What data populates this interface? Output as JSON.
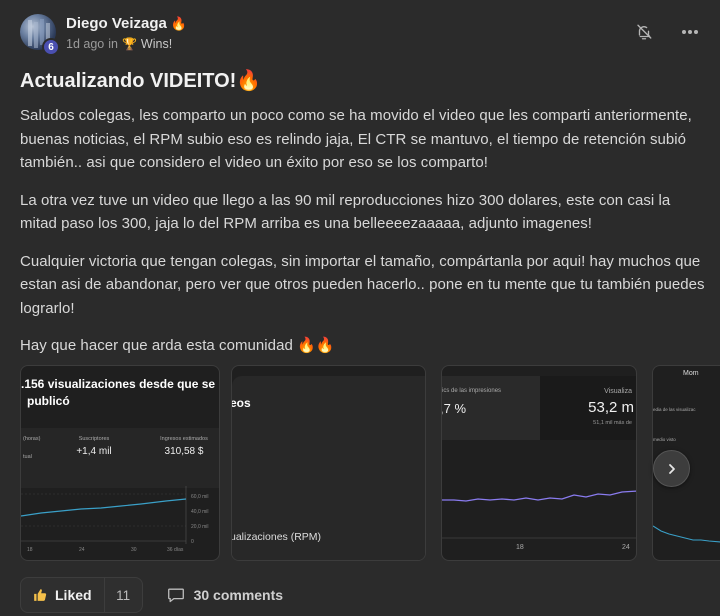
{
  "author": {
    "name": "Diego Veizaga",
    "name_emoji": "🔥",
    "level": "6"
  },
  "meta": {
    "time": "1d ago",
    "in_word": "in",
    "category_icon": "🏆",
    "category": "Wins!"
  },
  "post": {
    "title": "Actualizando VIDEITO!🔥",
    "paragraphs": [
      "Saludos colegas, les comparto un poco como se ha movido el video que les comparti anteriormente, buenas noticias, el RPM subio eso es relindo jaja, El CTR se mantuvo, el tiempo de retención subió también.. asi que considero el video un éxito por eso se los comparto!",
      "La otra vez tuve un video que llego a las 90 mil reproducciones hizo 300 dolares, este con casi la mitad paso los 300, jaja lo del RPM arriba es una belleeeezaaaaa, adjunto imagenes!",
      "Cualquier victoria que tengan colegas, sin importar el tamaño, compártanla por aqui! hay muchos que estan asi de abandonar, pero ver que otros pueden hacerlo.. pone en tu mente que tu también puedes lograrlo!",
      "Hay que hacer que arda esta comunidad 🔥🔥"
    ]
  },
  "gallery": {
    "img1": {
      "headline_1": ".156 visualizaciones desde que se",
      "headline_2": "publicó",
      "stat_left_label": "(horas)",
      "stat_left_sub": "tual",
      "stat_mid_label": "Suscriptores",
      "stat_mid_value": "+1,4 mil",
      "stat_right_label": "Ingresos estimados",
      "stat_right_value": "310,58 $",
      "y_ticks": [
        "60,0 mil",
        "40,0 mil",
        "20,0 mil",
        "0"
      ],
      "x_ticks": [
        "18",
        "24",
        "30",
        "36 días"
      ]
    },
    "img2": {
      "heading": "eos",
      "footer": "ualizaciones (RPM)"
    },
    "img3": {
      "left_label": "ics de las impresiones",
      "left_value": ",7 %",
      "right_label": "Visualiza",
      "right_value": "53,2 m",
      "right_sub": "51,1 mil más de",
      "x_ticks": [
        "18",
        "24"
      ]
    },
    "img4": {
      "heading": "Mom",
      "label_1": "edia de las visualizac",
      "label_2": "medio visto"
    }
  },
  "footer": {
    "like_label": "Liked",
    "like_count": "11",
    "comments_label": "30 comments"
  },
  "colors": {
    "background": "#2b2b2b",
    "chart_line_blue": "#3aa0c8",
    "chart_line_purple": "#8a7cf0",
    "level_badge": "#4a4fb0"
  }
}
